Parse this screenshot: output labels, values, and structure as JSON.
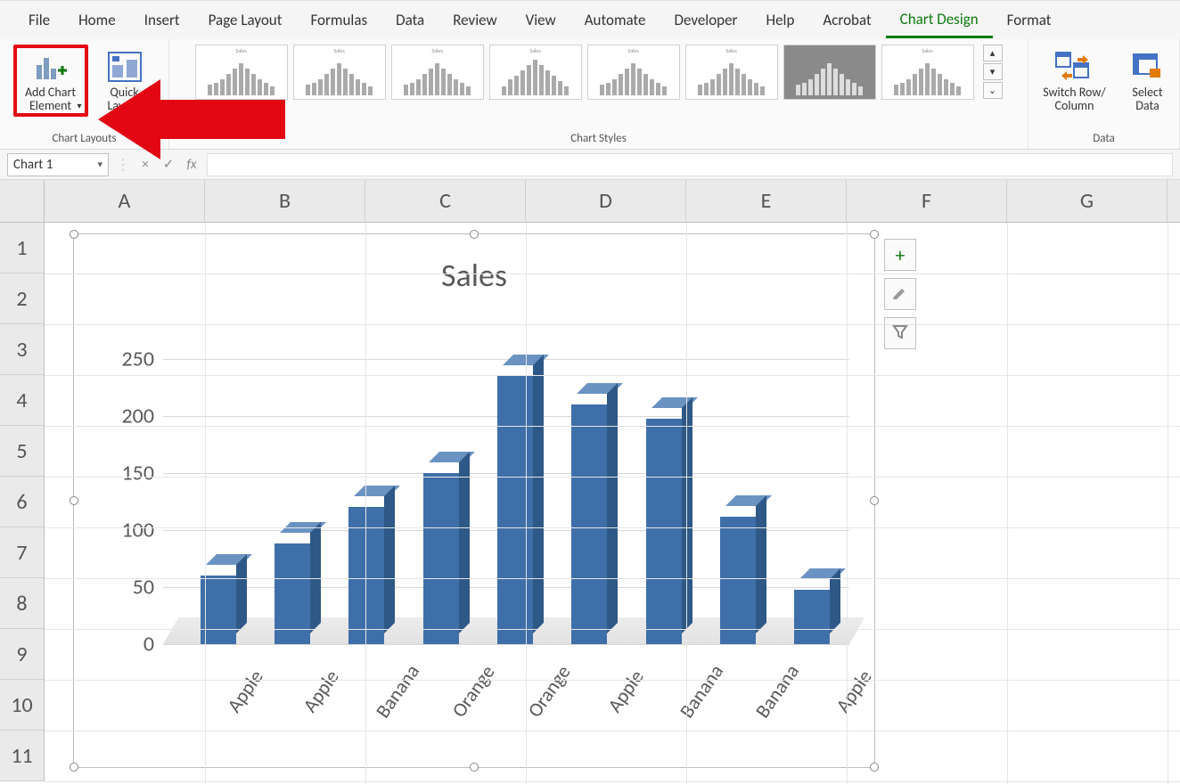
{
  "menu": {
    "items": [
      "File",
      "Home",
      "Insert",
      "Page Layout",
      "Formulas",
      "Data",
      "Review",
      "View",
      "Automate",
      "Developer",
      "Help",
      "Acrobat",
      "Chart Design",
      "Format"
    ],
    "active": "Chart Design"
  },
  "ribbon": {
    "chart_layouts": {
      "label": "Chart Layouts",
      "add_chart_element": "Add Chart\nElement",
      "quick_layout": "Quick\nLayout"
    },
    "chart_styles": {
      "label": "Chart Styles",
      "thumb_title": "Sales"
    },
    "data": {
      "label": "Data",
      "switch": "Switch Row/\nColumn",
      "select": "Select\nData"
    }
  },
  "formula_bar": {
    "name_box": "Chart 1",
    "fx_symbol": "fx",
    "cancel_symbol": "×",
    "confirm_symbol": "✓"
  },
  "grid": {
    "cols": [
      "A",
      "B",
      "C",
      "D",
      "E",
      "F",
      "G"
    ],
    "rows": [
      "1",
      "2",
      "3",
      "4",
      "5",
      "6",
      "7",
      "8",
      "9",
      "10",
      "11"
    ]
  },
  "chart_side": {
    "plus": "+",
    "brush": "✎",
    "filter": "▼"
  },
  "chart_data": {
    "type": "bar",
    "title": "Sales",
    "categories": [
      "Apple",
      "Apple",
      "Banana",
      "Orange",
      "Orange",
      "Apple",
      "Banana",
      "Banana",
      "Apple"
    ],
    "values": [
      60,
      88,
      120,
      150,
      235,
      210,
      198,
      112,
      48
    ],
    "ylim": [
      0,
      250
    ],
    "yticks": [
      0,
      50,
      100,
      150,
      200,
      250
    ],
    "xlabel": "",
    "ylabel": ""
  }
}
